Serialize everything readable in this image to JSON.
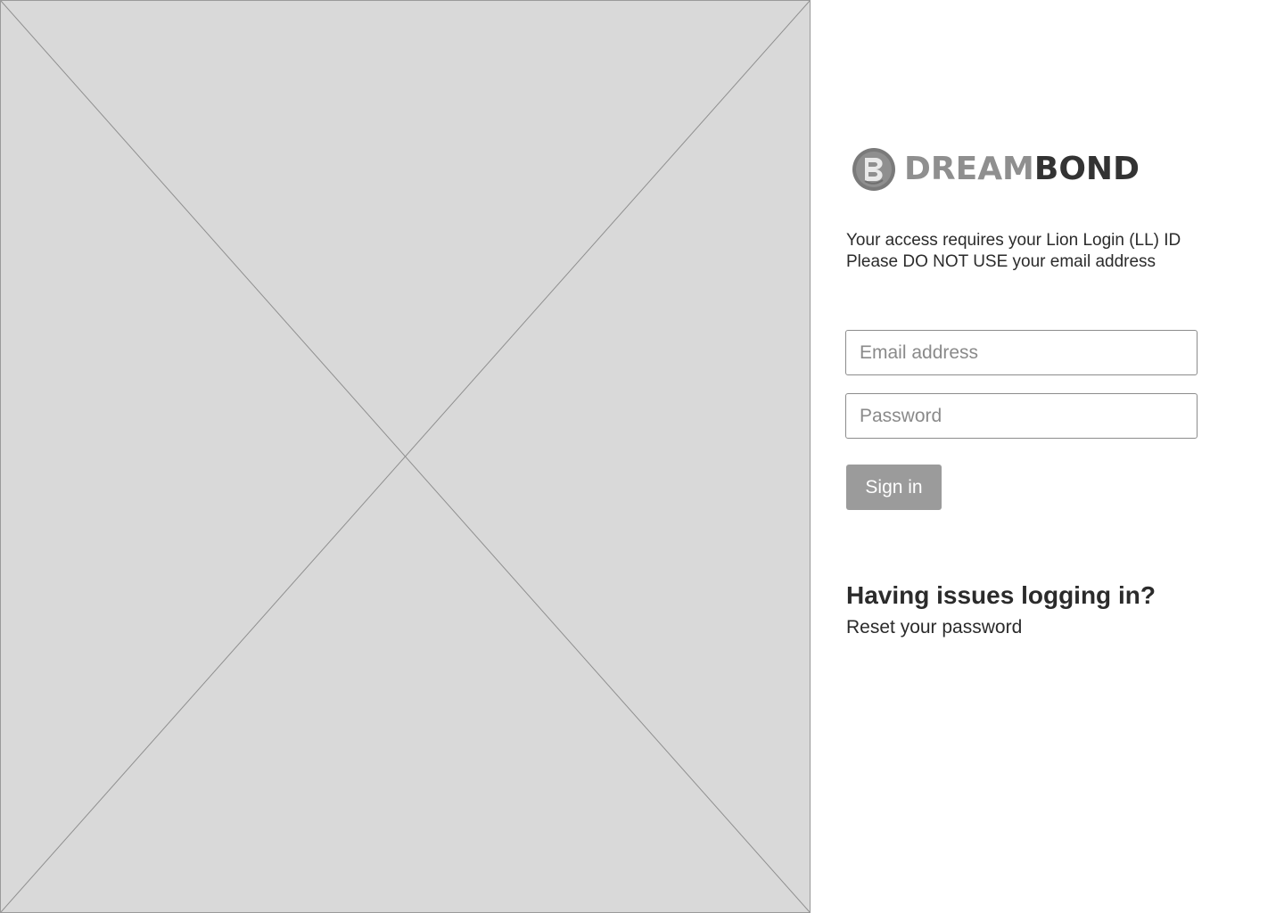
{
  "brand": {
    "name_light": "DREAM",
    "name_dark": "BOND",
    "logo_icon": "dreambond-logo-icon"
  },
  "notice": {
    "line1": "Your access requires your Lion Login (LL) ID",
    "line2": "Please DO NOT USE your email address"
  },
  "form": {
    "email_placeholder": "Email address",
    "email_value": "",
    "password_placeholder": "Password",
    "password_value": "",
    "signin_label": "Sign in"
  },
  "help": {
    "title": "Having issues logging in?",
    "reset_label": "Reset your password"
  },
  "colors": {
    "placeholder_bg": "#d9d9d9",
    "button_bg": "#9b9b9b",
    "text": "#2b2b2b",
    "logo_light": "#8f8f8f",
    "logo_dark": "#333333"
  }
}
